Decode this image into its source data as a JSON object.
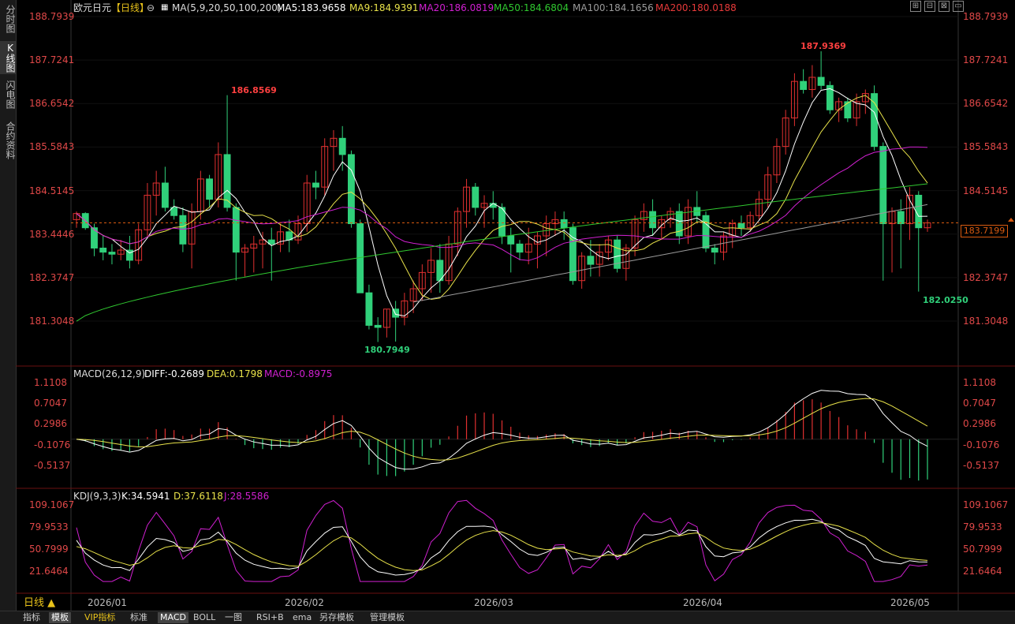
{
  "sidebar": {
    "tabs": [
      {
        "label": "分时图",
        "active": false
      },
      {
        "label": "K线图",
        "active": true
      },
      {
        "label": "闪电图",
        "active": false
      },
      {
        "label": "合约资料",
        "active": false
      }
    ]
  },
  "header": {
    "title": "欧元日元",
    "period": "【日线】",
    "ma_params": "MA(5,9,20,50,100,200)",
    "ma": [
      {
        "text": "MA5:183.9658",
        "color": "#ffffff"
      },
      {
        "text": "MA9:184.9391",
        "color": "#e8e24a"
      },
      {
        "text": "MA20:186.0819",
        "color": "#d020d0"
      },
      {
        "text": "MA50:184.6804",
        "color": "#30c830"
      },
      {
        "text": "MA100:184.1656",
        "color": "#9a9a9a"
      },
      {
        "text": "MA200:180.0188",
        "color": "#e83a3a"
      }
    ]
  },
  "price_axis": {
    "ticks": [
      "188.7939",
      "187.7241",
      "186.6542",
      "185.5843",
      "184.5145",
      "183.4446",
      "182.3747",
      "181.3048"
    ],
    "current": "183.7199"
  },
  "annotations": {
    "high_label": "187.9369",
    "peak_label": "186.8569",
    "low_label": "182.0250",
    "trough_label": "180.7949"
  },
  "macd_panel": {
    "title": "MACD(26,12,9)",
    "diff": "DIFF:-0.2689",
    "dea": "DEA:0.1798",
    "macd": "MACD:-0.8975",
    "ticks": [
      "1.1108",
      "0.7047",
      "0.2986",
      "-0.1076",
      "-0.5137"
    ]
  },
  "kdj_panel": {
    "title": "KDJ(9,3,3)",
    "k": "K:34.5941",
    "d": "D:37.6118",
    "j": "J:28.5586",
    "ticks": [
      "109.1067",
      "79.9533",
      "50.7999",
      "21.6464"
    ]
  },
  "date_axis": {
    "labels": [
      "2026/01",
      "2026/02",
      "2026/03",
      "2026/04",
      "2026/05"
    ]
  },
  "period_button": "日线 ▲",
  "toolbar": {
    "items": [
      "指标",
      "模板",
      "VIP指标",
      "标准",
      "MACD",
      "BOLL",
      "一图",
      "RSI+B",
      "ema",
      "另存模板",
      "管理模板"
    ]
  },
  "colors": {
    "up": "#e03030",
    "down": "#30d07a",
    "ma5": "#ffffff",
    "ma9": "#e8e24a",
    "ma20": "#d020d0",
    "ma50": "#30c830",
    "ma100": "#9a9a9a"
  },
  "chart_data": {
    "type": "candlestick",
    "dates_first": "2026/01",
    "dates_last": "2026/05",
    "candles": [
      [
        183.8,
        184.0,
        183.6,
        183.95
      ],
      [
        183.95,
        183.98,
        183.55,
        183.6
      ],
      [
        183.6,
        183.7,
        182.9,
        183.1
      ],
      [
        183.1,
        183.4,
        182.8,
        183.0
      ],
      [
        183.0,
        183.2,
        182.7,
        182.95
      ],
      [
        182.95,
        183.3,
        182.8,
        183.05
      ],
      [
        183.05,
        183.4,
        182.6,
        182.8
      ],
      [
        182.8,
        183.7,
        182.7,
        183.55
      ],
      [
        183.55,
        184.7,
        183.4,
        184.4
      ],
      [
        184.4,
        185.0,
        183.9,
        184.7
      ],
      [
        184.7,
        185.1,
        184.0,
        184.1
      ],
      [
        184.1,
        184.3,
        183.8,
        183.9
      ],
      [
        183.9,
        184.1,
        183.0,
        183.2
      ],
      [
        183.2,
        184.2,
        182.6,
        184.0
      ],
      [
        184.0,
        185.0,
        183.8,
        184.8
      ],
      [
        184.8,
        184.9,
        184.1,
        184.3
      ],
      [
        184.3,
        185.7,
        184.1,
        185.4
      ],
      [
        185.4,
        186.86,
        184.0,
        184.1
      ],
      [
        184.1,
        184.2,
        182.3,
        183.0
      ],
      [
        183.0,
        183.2,
        182.4,
        183.1
      ],
      [
        183.1,
        183.4,
        182.5,
        183.2
      ],
      [
        183.2,
        183.5,
        182.6,
        183.3
      ],
      [
        183.3,
        183.6,
        182.3,
        183.2
      ],
      [
        183.2,
        183.7,
        183.0,
        183.5
      ],
      [
        183.5,
        183.8,
        183.0,
        183.3
      ],
      [
        183.3,
        183.9,
        183.2,
        183.7
      ],
      [
        183.7,
        184.9,
        183.5,
        184.7
      ],
      [
        184.7,
        185.0,
        184.3,
        184.6
      ],
      [
        184.6,
        185.8,
        184.4,
        185.6
      ],
      [
        185.6,
        186.0,
        185.0,
        185.8
      ],
      [
        185.8,
        186.1,
        185.0,
        185.4
      ],
      [
        185.4,
        185.5,
        183.6,
        183.7
      ],
      [
        183.7,
        183.8,
        182.0,
        182.0
      ],
      [
        182.0,
        182.2,
        181.1,
        181.2
      ],
      [
        181.2,
        181.4,
        180.79,
        181.15
      ],
      [
        181.15,
        181.6,
        180.9,
        181.6
      ],
      [
        181.6,
        181.8,
        180.8,
        181.4
      ],
      [
        181.4,
        182.0,
        181.2,
        181.8
      ],
      [
        181.8,
        182.3,
        181.5,
        182.1
      ],
      [
        182.1,
        182.7,
        181.8,
        182.5
      ],
      [
        182.5,
        183.1,
        182.0,
        182.8
      ],
      [
        182.8,
        183.2,
        182.0,
        182.3
      ],
      [
        182.3,
        183.4,
        182.2,
        183.2
      ],
      [
        183.2,
        184.1,
        182.9,
        184.0
      ],
      [
        184.0,
        184.8,
        183.6,
        184.6
      ],
      [
        184.6,
        184.7,
        183.9,
        184.1
      ],
      [
        184.1,
        184.4,
        183.6,
        184.2
      ],
      [
        184.2,
        184.5,
        183.8,
        184.1
      ],
      [
        184.1,
        184.2,
        183.2,
        183.4
      ],
      [
        183.4,
        183.6,
        182.5,
        183.2
      ],
      [
        183.2,
        183.3,
        182.8,
        183.0
      ],
      [
        183.0,
        183.6,
        182.7,
        183.2
      ],
      [
        183.2,
        183.5,
        182.6,
        183.4
      ],
      [
        183.4,
        183.9,
        182.9,
        183.7
      ],
      [
        183.7,
        184.0,
        183.4,
        183.8
      ],
      [
        183.8,
        184.0,
        183.3,
        183.6
      ],
      [
        183.6,
        183.7,
        182.2,
        182.3
      ],
      [
        182.3,
        183.0,
        182.1,
        182.9
      ],
      [
        182.9,
        183.3,
        182.4,
        182.7
      ],
      [
        182.7,
        183.2,
        182.4,
        183.0
      ],
      [
        183.0,
        183.4,
        182.8,
        183.3
      ],
      [
        183.3,
        183.4,
        182.5,
        182.6
      ],
      [
        182.6,
        183.2,
        182.3,
        183.1
      ],
      [
        183.1,
        183.9,
        182.9,
        183.8
      ],
      [
        183.8,
        184.2,
        183.5,
        184.0
      ],
      [
        184.0,
        184.3,
        183.4,
        183.6
      ],
      [
        183.6,
        183.9,
        183.3,
        183.8
      ],
      [
        183.8,
        184.1,
        183.6,
        184.0
      ],
      [
        184.0,
        184.2,
        183.2,
        183.4
      ],
      [
        183.4,
        184.3,
        183.2,
        184.1
      ],
      [
        184.1,
        184.5,
        183.7,
        183.9
      ],
      [
        183.9,
        184.0,
        183.0,
        183.1
      ],
      [
        183.1,
        183.2,
        182.7,
        183.0
      ],
      [
        183.0,
        183.5,
        182.8,
        183.4
      ],
      [
        183.4,
        183.8,
        183.1,
        183.7
      ],
      [
        183.7,
        183.9,
        183.4,
        183.6
      ],
      [
        183.6,
        184.0,
        183.5,
        183.9
      ],
      [
        183.9,
        184.5,
        183.8,
        184.3
      ],
      [
        184.3,
        185.1,
        184.1,
        184.9
      ],
      [
        184.9,
        185.8,
        184.7,
        185.6
      ],
      [
        185.6,
        186.5,
        185.4,
        186.3
      ],
      [
        186.3,
        187.4,
        186.1,
        187.2
      ],
      [
        187.2,
        187.5,
        186.9,
        187.0
      ],
      [
        187.0,
        187.6,
        186.8,
        187.3
      ],
      [
        187.3,
        187.94,
        187.0,
        187.1
      ],
      [
        187.1,
        187.2,
        186.4,
        186.5
      ],
      [
        186.5,
        186.8,
        186.2,
        186.7
      ],
      [
        186.7,
        186.8,
        186.2,
        186.3
      ],
      [
        186.3,
        186.9,
        186.1,
        186.7
      ],
      [
        186.7,
        187.0,
        186.4,
        186.9
      ],
      [
        186.9,
        187.1,
        185.5,
        185.6
      ],
      [
        185.6,
        185.7,
        182.3,
        183.7
      ],
      [
        183.7,
        184.1,
        182.5,
        184.0
      ],
      [
        184.0,
        184.3,
        182.6,
        183.7
      ],
      [
        183.7,
        184.6,
        183.3,
        184.4
      ],
      [
        184.4,
        184.5,
        182.03,
        183.6
      ],
      [
        183.6,
        183.8,
        183.5,
        183.72
      ]
    ],
    "macd": {
      "diff_last": -0.2689,
      "dea_last": 0.1798,
      "hist_last": -0.8975
    },
    "kdj": {
      "k_last": 34.5941,
      "d_last": 37.6118,
      "j_last": 28.5586
    }
  }
}
